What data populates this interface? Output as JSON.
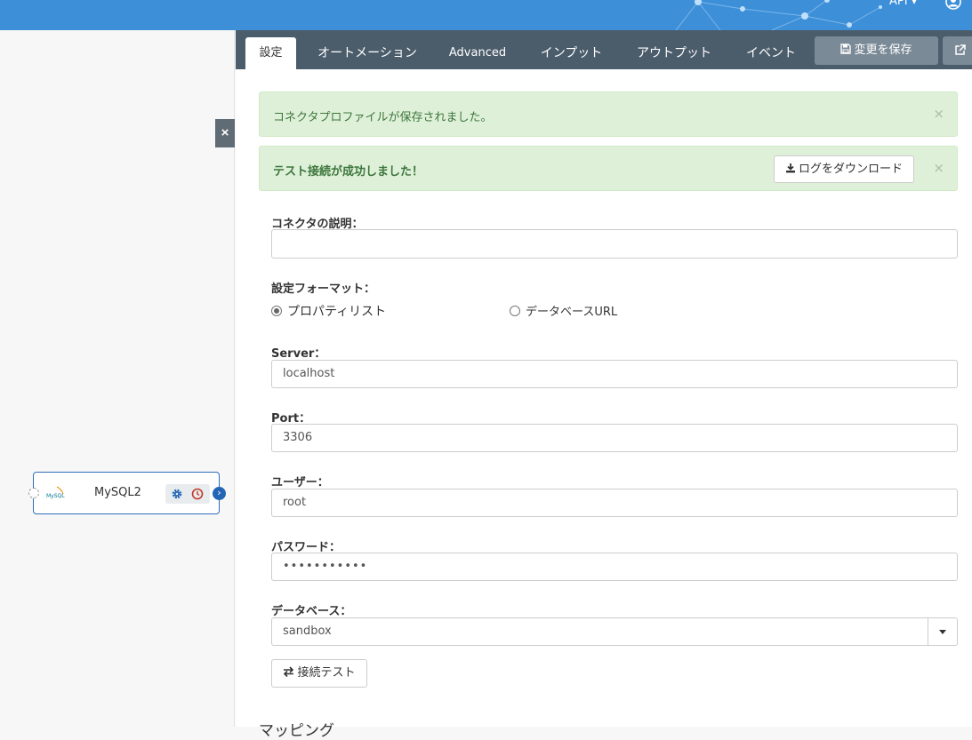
{
  "topbar": {
    "api_label": "API ▾"
  },
  "canvas": {
    "close_glyph": "×",
    "node": {
      "name": "MySQL2",
      "logo_text": "MySQL"
    }
  },
  "tabs": [
    {
      "label": "設定",
      "active": true
    },
    {
      "label": "オートメーション"
    },
    {
      "label": "Advanced"
    },
    {
      "label": "インプット"
    },
    {
      "label": "アウトプット"
    },
    {
      "label": "イベント"
    }
  ],
  "toolbar": {
    "save_label": "変更を保存"
  },
  "alerts": {
    "saved": {
      "message": "コネクタプロファイルが保存されました。"
    },
    "test": {
      "message": "テスト接続が成功しました！",
      "download_label": "ログをダウンロード"
    },
    "close_glyph": "×"
  },
  "form": {
    "description_label": "コネクタの説明：",
    "format_label": "設定フォーマット：",
    "format_options": [
      "プロパティリスト",
      "データベースURL"
    ],
    "server_label": "Server：",
    "server_value": "localhost",
    "port_label": "Port：",
    "port_value": "3306",
    "user_label": "ユーザー：",
    "user_value": "root",
    "password_label": "パスワード：",
    "password_value": "•••••••••••",
    "database_label": "データベース：",
    "database_value": "sandbox",
    "test_button_label": "接続テスト"
  },
  "mapping": {
    "title": "マッピング"
  },
  "colors": {
    "topbar": "#3d8fd8",
    "tabbar": "#4b5c6b",
    "success_bg": "#dff0d8",
    "success_text": "#3c763d",
    "node_border": "#2e6eb8"
  }
}
